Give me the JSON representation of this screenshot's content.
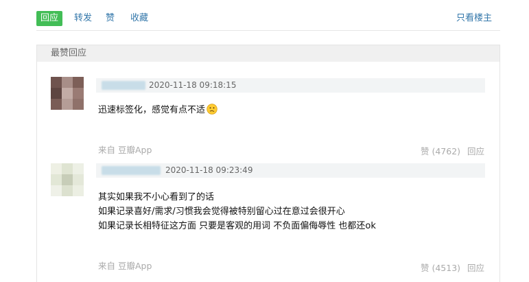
{
  "tabs": [
    {
      "label": "回应",
      "active": true
    },
    {
      "label": "转发",
      "active": false
    },
    {
      "label": "赞",
      "active": false
    },
    {
      "label": "收藏",
      "active": false
    }
  ],
  "only_op_label": "只看楼主",
  "panel_title": "最赞回应",
  "comments": [
    {
      "timestamp": "2020-11-18 09:18:15",
      "lines": [
        "迅速标签化，感觉有点不适"
      ],
      "emoji": "confused-face",
      "source": "来自 豆瓣App",
      "like_label": "赞 (4762)",
      "reply_label": "回应"
    },
    {
      "timestamp": "2020-11-18 09:23:49",
      "lines": [
        "其实如果我不小心看到了的话",
        "如果记录喜好/需求/习惯我会觉得被特别留心过在意过会很开心",
        "如果记录长相特征这方面 只要是客观的用词 不负面偏侮辱性 也都还ok"
      ],
      "source": "来自 豆瓣App",
      "like_label": "赞 (4513)",
      "reply_label": "回应"
    }
  ],
  "colors": {
    "accent_green": "#42bd56",
    "link_blue": "#3377aa",
    "muted": "#aaaaaa"
  }
}
